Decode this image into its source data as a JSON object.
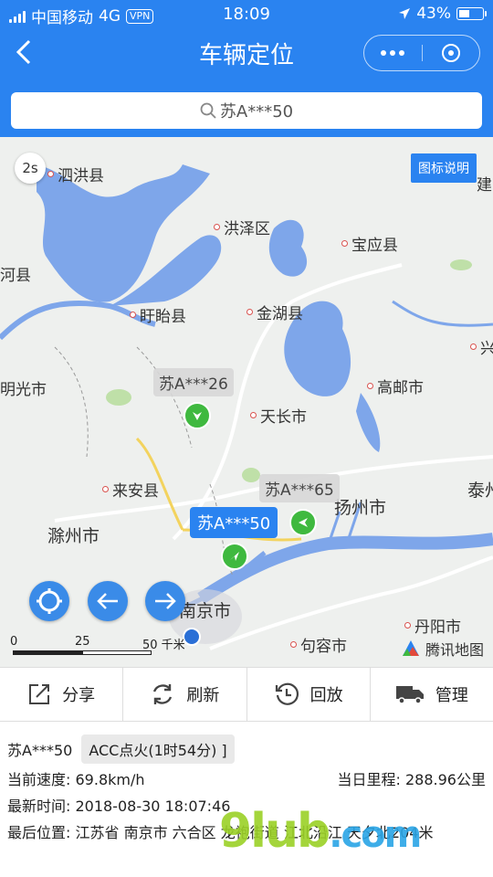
{
  "status_bar": {
    "carrier": "中国移动",
    "network": "4G",
    "vpn": "VPN",
    "time": "18:09",
    "battery": "43%"
  },
  "header": {
    "title": "车辆定位"
  },
  "search": {
    "query": "苏A***50"
  },
  "map": {
    "refresh_interval": "2s",
    "legend_button": "图标说明",
    "cities": {
      "sihong": "泗洪县",
      "hongze": "洪泽区",
      "baoying": "宝应县",
      "he": "河县",
      "xuyi": "盱眙县",
      "jinhu": "金湖县",
      "xing": "兴",
      "mingguang": "明光市",
      "tianchang": "天长市",
      "gaoyou": "高邮市",
      "laian": "来安县",
      "yangzhou": "扬州市",
      "tai": "泰州",
      "jian": "建",
      "chuzhou": "滁州市",
      "nanjing": "南京市",
      "jurong": "句容市",
      "danyang": "丹阳市"
    },
    "vehicles": [
      {
        "plate": "苏A***26",
        "status": "moving"
      },
      {
        "plate": "苏A***65",
        "status": "moving"
      },
      {
        "plate": "苏A***50",
        "status": "selected"
      }
    ],
    "scale": {
      "t0": "0",
      "t1": "25",
      "t2": "50 千米"
    },
    "provider": "腾讯地图"
  },
  "toolbar": {
    "share": "分享",
    "refresh": "刷新",
    "playback": "回放",
    "manage": "管理"
  },
  "info": {
    "plate": "苏A***50",
    "acc": "ACC点火(1时54分) ]",
    "speed_label": "当前速度:",
    "speed": "69.8km/h",
    "mileage_label": "当日里程:",
    "mileage": "288.96公里",
    "time_label": "最新时间:",
    "time": "2018-08-30 18:07:46",
    "location_label": "最后位置:",
    "location": "江苏省 南京市 六合区 龙袍街道 江北沿江 天夕北204米"
  },
  "watermark": {
    "main": "9lub",
    "suffix": ".com"
  },
  "colors": {
    "primary": "#2a83f0",
    "vehicle": "#3fb93f",
    "water": "#7ea6ea"
  }
}
